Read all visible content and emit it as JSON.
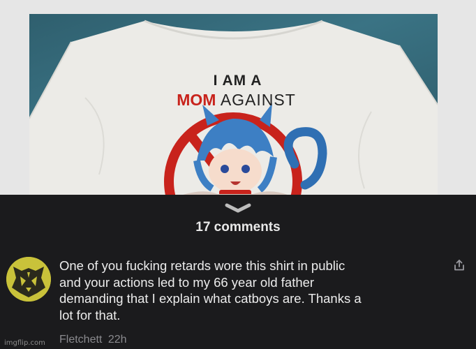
{
  "post": {
    "image": {
      "shirt_line1": "I AM A",
      "shirt_line2_accent": "MOM",
      "shirt_line2_rest": "AGAINST",
      "icon": "no-catboys-sign-illustration"
    }
  },
  "comments_header": {
    "expand_icon": "chevron-down-icon",
    "count_label": "17 comments"
  },
  "comment": {
    "avatar_icon": "wolf-head-avatar",
    "lines": [
      "One of you fucking retards wore this shirt in public",
      "and your actions led to my 66 year old father",
      "demanding that I explain what catboys are. Thanks a",
      "lot for that."
    ],
    "author": "Fletchett",
    "time": "22h",
    "share_icon": "share-icon"
  },
  "watermark": "imgflip.com",
  "colors": {
    "panel_bg": "#1b1b1d",
    "text": "#ececec",
    "meta": "#8a8a8e",
    "avatar": "#c9c23a",
    "shirt_accent": "#c8231c"
  }
}
